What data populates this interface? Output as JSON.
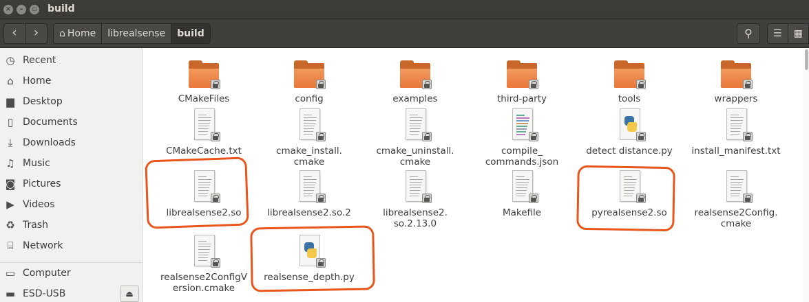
{
  "window": {
    "title": "build"
  },
  "toolbar": {
    "breadcrumbs": [
      "Home",
      "librealsense",
      "build"
    ]
  },
  "sidebar": {
    "items": [
      {
        "label": "Recent",
        "icon": "clock-icon"
      },
      {
        "label": "Home",
        "icon": "home-icon"
      },
      {
        "label": "Desktop",
        "icon": "folder-icon"
      },
      {
        "label": "Documents",
        "icon": "document-icon"
      },
      {
        "label": "Downloads",
        "icon": "download-icon"
      },
      {
        "label": "Music",
        "icon": "music-icon"
      },
      {
        "label": "Pictures",
        "icon": "camera-icon"
      },
      {
        "label": "Videos",
        "icon": "video-icon"
      },
      {
        "label": "Trash",
        "icon": "trash-icon"
      },
      {
        "label": "Network",
        "icon": "network-icon"
      },
      {
        "label": "Computer",
        "icon": "computer-icon"
      },
      {
        "label": "ESD-USB",
        "icon": "drive-icon"
      }
    ]
  },
  "files": [
    {
      "name": "CMakeFiles",
      "type": "folder"
    },
    {
      "name": "config",
      "type": "folder"
    },
    {
      "name": "examples",
      "type": "folder"
    },
    {
      "name": "third-party",
      "type": "folder"
    },
    {
      "name": "tools",
      "type": "folder"
    },
    {
      "name": "wrappers",
      "type": "folder"
    },
    {
      "name": "CMakeCache.txt",
      "type": "text"
    },
    {
      "name": "cmake_install.\ncmake",
      "type": "text"
    },
    {
      "name": "cmake_uninstall.\ncmake",
      "type": "text"
    },
    {
      "name": "compile_\ncommands.json",
      "type": "json"
    },
    {
      "name": "detect distance.py",
      "type": "python"
    },
    {
      "name": "install_manifest.txt",
      "type": "text"
    },
    {
      "name": "librealsense2.so",
      "type": "text"
    },
    {
      "name": "librealsense2.so.2",
      "type": "text"
    },
    {
      "name": "librealsense2.\nso.2.13.0",
      "type": "text"
    },
    {
      "name": "Makefile",
      "type": "text"
    },
    {
      "name": "pyrealsense2.so",
      "type": "text"
    },
    {
      "name": "realsense2Config.\ncmake",
      "type": "text"
    },
    {
      "name": "realsense2ConfigV\nersion.cmake",
      "type": "text"
    },
    {
      "name": "realsense_depth.py",
      "type": "python"
    }
  ],
  "annotation_color": "#e8561b"
}
